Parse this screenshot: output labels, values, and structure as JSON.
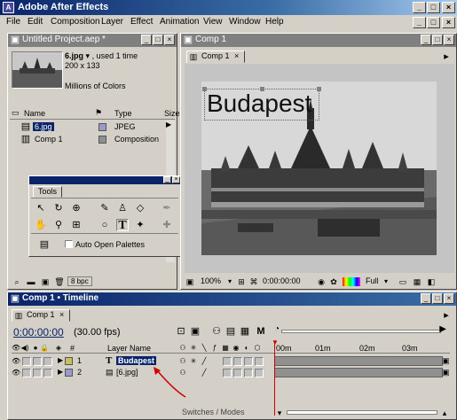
{
  "app": {
    "title": "Adobe After Effects"
  },
  "menu": [
    "File",
    "Edit",
    "Composition",
    "Layer",
    "Effect",
    "Animation",
    "View",
    "Window",
    "Help"
  ],
  "project": {
    "title": "Untitled Project.aep *",
    "selected_name": "6.jpg",
    "selected_usage": ", used 1 time",
    "dimensions": "200 x 133",
    "color_depth": "Millions of Colors",
    "columns": [
      "Name",
      "Type",
      "Size"
    ],
    "items": [
      {
        "name": "6.jpg",
        "type": "JPEG"
      },
      {
        "name": "Comp 1",
        "type": "Composition"
      }
    ],
    "bpc": "8 bpc"
  },
  "tools": {
    "title": "Tools",
    "auto_open_label": "Auto Open Palettes"
  },
  "comp": {
    "title": "Comp 1",
    "tab": "Comp 1",
    "overlay_text": "Budapest",
    "zoom": "100%",
    "timecode": "0:00:00:00",
    "quality": "Full"
  },
  "timeline": {
    "title": "Comp 1 • Timeline",
    "tab": "Comp 1",
    "timecode": "0:00:00:00",
    "fps": "(30.00 fps)",
    "layer_header": "Layer Name",
    "ruler": [
      "00m",
      "01m",
      "02m",
      "03m"
    ],
    "layers": [
      {
        "num": "1",
        "name": "Budapest"
      },
      {
        "num": "2",
        "name": "[6.jpg]"
      }
    ],
    "footer": "Switches / Modes"
  },
  "colors": {
    "accent": "#0a246a",
    "panel": "#d4d0c8",
    "timeline_bar": "#909090",
    "indicator": "#cc0000"
  }
}
